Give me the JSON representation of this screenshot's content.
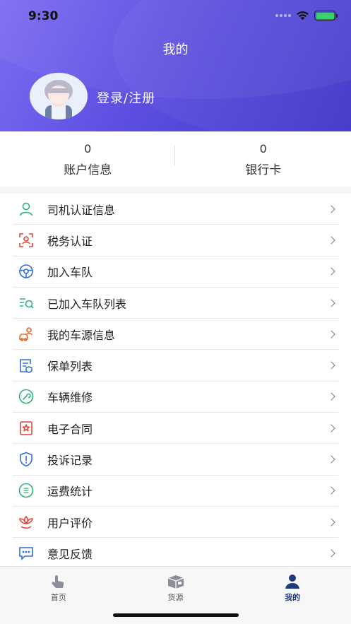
{
  "status_bar": {
    "time": "9:30"
  },
  "header": {
    "title": "我的",
    "login_label": "登录/注册"
  },
  "stats": [
    {
      "value": "0",
      "label": "账户信息"
    },
    {
      "value": "0",
      "label": "银行卡"
    }
  ],
  "menu": [
    {
      "label": "司机认证信息",
      "icon": "driver-person-icon",
      "color": "#2db37a"
    },
    {
      "label": "税务认证",
      "icon": "face-scan-icon",
      "color": "#e0443a"
    },
    {
      "label": "加入车队",
      "icon": "steering-wheel-icon",
      "color": "#2f6fd6"
    },
    {
      "label": "已加入车队列表",
      "icon": "list-search-icon",
      "color": "#2db37a"
    },
    {
      "label": "我的车源信息",
      "icon": "car-person-icon",
      "color": "#e26a2c"
    },
    {
      "label": "保单列表",
      "icon": "policy-doc-icon",
      "color": "#2f6fd6"
    },
    {
      "label": "车辆维修",
      "icon": "wrench-icon",
      "color": "#2db37a"
    },
    {
      "label": "电子合同",
      "icon": "contract-stamp-icon",
      "color": "#e0443a"
    },
    {
      "label": "投诉记录",
      "icon": "shield-alert-icon",
      "color": "#2f6fd6"
    },
    {
      "label": "运费统计",
      "icon": "freight-stats-icon",
      "color": "#2db37a"
    },
    {
      "label": "用户评价",
      "icon": "review-lotus-icon",
      "color": "#e0443a"
    },
    {
      "label": "意见反馈",
      "icon": "feedback-chat-icon",
      "color": "#2f6fd6"
    }
  ],
  "tabbar": [
    {
      "label": "首页",
      "icon": "home-hand-icon",
      "active": false
    },
    {
      "label": "货源",
      "icon": "cargo-truck-icon",
      "active": false
    },
    {
      "label": "我的",
      "icon": "profile-person-icon",
      "active": true
    }
  ],
  "colors": {
    "header_start": "#7c6cf2",
    "header_end": "#3f37c9",
    "active_tab": "#1d3b7a"
  }
}
